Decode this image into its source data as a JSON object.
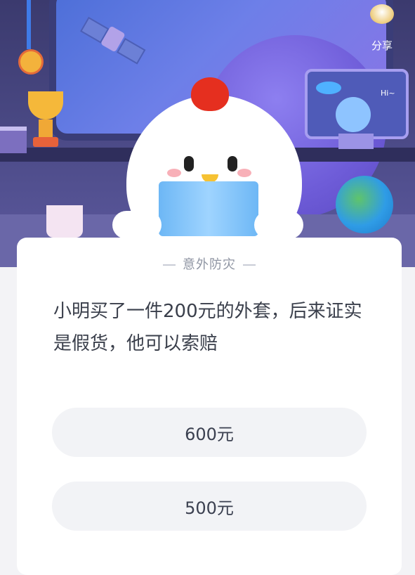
{
  "header": {
    "share_label": "分享",
    "monitor_text": "Hi~"
  },
  "card": {
    "category": "意外防灾",
    "question": "小明买了一件200元的外套，后来证实是假货，他可以索赔",
    "options": [
      {
        "label": "600元"
      },
      {
        "label": "500元"
      }
    ]
  },
  "colors": {
    "card_bg": "#ffffff",
    "option_bg": "#f2f3f6",
    "scene_bg": "#474680"
  }
}
